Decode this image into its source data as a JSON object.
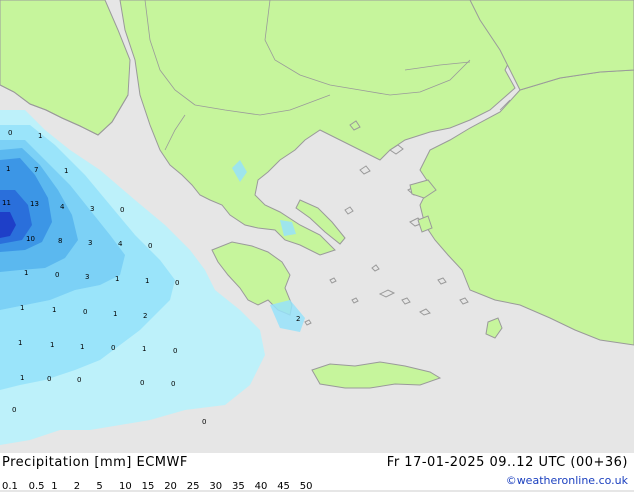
{
  "title": "Precipitation [mm]  ECMWF",
  "datetime": "Fr 17-01-2025 09..12 UTC (00+36)",
  "credit": "©weatheronline.co.uk",
  "colors": {
    "sea": "#e6e6e6",
    "land": "#c6f59c",
    "coast": "#9a9a9a"
  },
  "legend": {
    "labels": [
      "0.1",
      "0.5",
      "1",
      "2",
      "5",
      "10",
      "15",
      "20",
      "25",
      "30",
      "35",
      "40",
      "45",
      "50"
    ],
    "colors": [
      "#ffffff",
      "#aeeefe",
      "#96e2fa",
      "#7ad0f5",
      "#5bb8ef",
      "#3c96e6",
      "#2a6fdb",
      "#1e3fc8",
      "#101a8c",
      "#9a1ae0",
      "#bb1ae6",
      "#d21ad8",
      "#e11ac6",
      "#f01aa8"
    ]
  },
  "point_values": [
    {
      "v": "0"
    },
    {
      "v": "1"
    },
    {
      "v": "1"
    },
    {
      "v": "7"
    },
    {
      "v": "1"
    },
    {
      "v": "11"
    },
    {
      "v": "13"
    },
    {
      "v": "4"
    },
    {
      "v": "3"
    },
    {
      "v": "0"
    },
    {
      "v": "10"
    },
    {
      "v": "8"
    },
    {
      "v": "3"
    },
    {
      "v": "4"
    },
    {
      "v": "0"
    },
    {
      "v": "1"
    },
    {
      "v": "0"
    },
    {
      "v": "3"
    },
    {
      "v": "1"
    },
    {
      "v": "1"
    },
    {
      "v": "0"
    },
    {
      "v": "1"
    },
    {
      "v": "1"
    },
    {
      "v": "0"
    },
    {
      "v": "1"
    },
    {
      "v": "2"
    },
    {
      "v": "1"
    },
    {
      "v": "1"
    },
    {
      "v": "1"
    },
    {
      "v": "0"
    },
    {
      "v": "1"
    },
    {
      "v": "0"
    },
    {
      "v": "1"
    },
    {
      "v": "0"
    },
    {
      "v": "0"
    },
    {
      "v": "0"
    },
    {
      "v": "0"
    },
    {
      "v": "0"
    },
    {
      "v": "0"
    },
    {
      "v": "2"
    }
  ]
}
